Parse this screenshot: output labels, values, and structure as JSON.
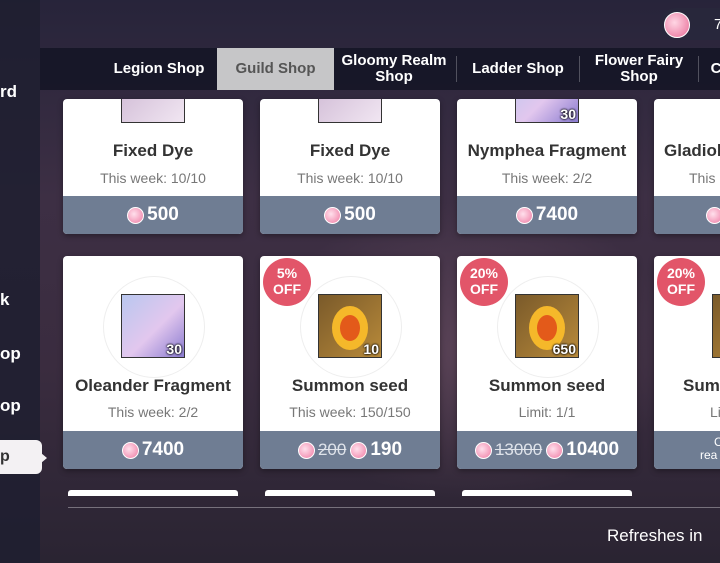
{
  "currency": {
    "icon": "pink-gem-icon",
    "value": "7"
  },
  "sidebar": {
    "items": [
      {
        "label": "rd"
      },
      {
        "label": "k"
      },
      {
        "label": "op"
      },
      {
        "label": "op"
      },
      {
        "label": "p"
      }
    ]
  },
  "tabs": [
    {
      "label": "Legion Shop"
    },
    {
      "label": "Guild Shop"
    },
    {
      "label": "Gloomy Realm Shop"
    },
    {
      "label": "Ladder Shop"
    },
    {
      "label": "Flower Fairy Shop"
    },
    {
      "label": "C"
    }
  ],
  "row1": [
    {
      "name": "Fixed Dye",
      "limit": "This week: 10/10",
      "price": "500"
    },
    {
      "name": "Fixed Dye",
      "limit": "This week: 10/10",
      "price": "500"
    },
    {
      "name": "Nymphea Fragment",
      "limit": "This week: 2/2",
      "price": "7400",
      "qty": "30"
    },
    {
      "name": "Gladiol",
      "limit": "This",
      "price": ""
    }
  ],
  "row2": [
    {
      "name": "Oleander Fragment",
      "limit": "This week: 2/2",
      "price": "7400",
      "qty": "30",
      "badge": ""
    },
    {
      "name": "Summon seed",
      "limit": "This week: 150/150",
      "old_price": "200",
      "price": "190",
      "qty": "10",
      "badge": "5% OFF"
    },
    {
      "name": "Summon seed",
      "limit": "Limit: 1/1",
      "old_price": "13000",
      "price": "10400",
      "qty": "650",
      "badge": "20% OFF"
    },
    {
      "name": "Sum",
      "limit": "Li",
      "badge": "20% OFF",
      "note1": "C",
      "note2": "rea"
    }
  ],
  "footer": {
    "refresh": "Refreshes in"
  },
  "colors": {
    "price_bar": "#6f7d93",
    "badge": "#e25569",
    "gem": "#ef7aa3"
  }
}
